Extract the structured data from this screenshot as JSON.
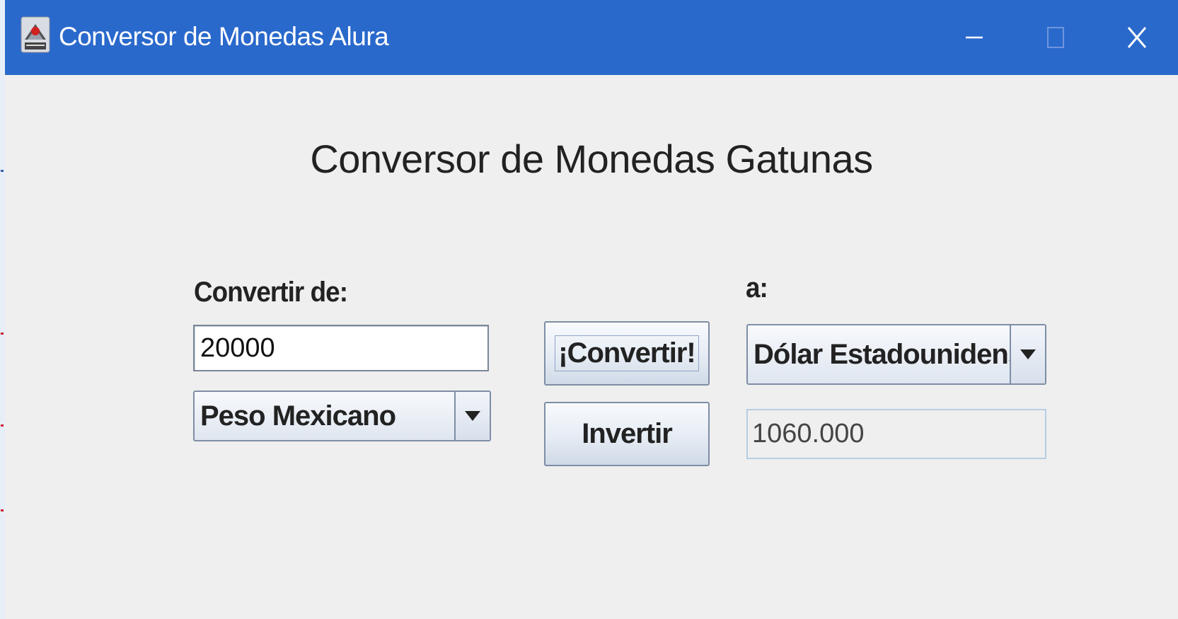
{
  "window": {
    "title": "Conversor de Monedas Alura",
    "controls": {
      "minimize": "minimize-icon",
      "maximize": "maximize-icon",
      "close": "close-icon"
    },
    "titlebar_color": "#2a69cc"
  },
  "main": {
    "heading": "Conversor de Monedas Gatunas",
    "from": {
      "label": "Convertir de:",
      "amount": "20000",
      "currency": "Peso Mexicano"
    },
    "to": {
      "label": "a:",
      "currency": "Dólar Estadounidense",
      "result": "1060.000"
    },
    "buttons": {
      "convert": "¡Convertir!",
      "invert": "Invertir"
    }
  },
  "colors": {
    "window_bg": "#efefef",
    "button_border": "#7e8ea5"
  }
}
